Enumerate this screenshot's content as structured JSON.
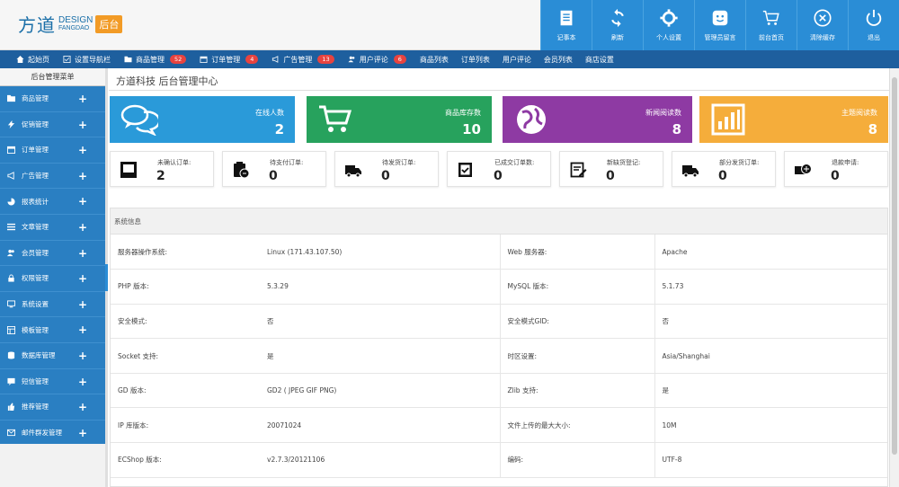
{
  "header": {
    "logo_cn": "方道",
    "logo_en1": "DESIGN",
    "logo_en2": "FANGDAO",
    "logo_badge": "后台",
    "tools": [
      {
        "label": "记事本",
        "icon": "notepad-icon"
      },
      {
        "label": "刷新",
        "icon": "refresh-icon"
      },
      {
        "label": "个人设置",
        "icon": "gear-icon"
      },
      {
        "label": "管理员留言",
        "icon": "message-icon"
      },
      {
        "label": "前台首页",
        "icon": "cart-icon"
      },
      {
        "label": "清除缓存",
        "icon": "close-circle-icon"
      },
      {
        "label": "退出",
        "icon": "power-icon"
      }
    ]
  },
  "nav": {
    "home": "起始页",
    "settings": "设置导航栏",
    "goods": "商品管理",
    "goods_badge": "52",
    "orders": "订单管理",
    "orders_badge": "4",
    "ads": "广告管理",
    "ads_badge": "13",
    "comments": "用户评论",
    "comments_badge": "6",
    "links": [
      "商品列表",
      "订单列表",
      "用户评论",
      "会员列表",
      "商店设置"
    ]
  },
  "sidebar": {
    "title": "后台管理菜单",
    "items": [
      {
        "label": "商品管理",
        "icon": "folder-icon"
      },
      {
        "label": "促销管理",
        "icon": "bolt-icon"
      },
      {
        "label": "订单管理",
        "icon": "calendar-icon"
      },
      {
        "label": "广告管理",
        "icon": "megaphone-icon"
      },
      {
        "label": "报表统计",
        "icon": "pie-icon"
      },
      {
        "label": "文章管理",
        "icon": "list-icon"
      },
      {
        "label": "会员管理",
        "icon": "users-icon"
      },
      {
        "label": "权限管理",
        "icon": "lock-icon"
      },
      {
        "label": "系统设置",
        "icon": "monitor-icon"
      },
      {
        "label": "模板管理",
        "icon": "template-icon"
      },
      {
        "label": "数据库管理",
        "icon": "database-icon"
      },
      {
        "label": "短信管理",
        "icon": "sms-icon"
      },
      {
        "label": "推荐管理",
        "icon": "thumb-icon"
      },
      {
        "label": "邮件群发管理",
        "icon": "mail-icon"
      }
    ]
  },
  "main": {
    "title": "方道科技 后台管理中心",
    "stats": [
      {
        "label": "在线人数",
        "value": "2",
        "color": "#2a9ad9",
        "icon": "chat-icon"
      },
      {
        "label": "商品库存数",
        "value": "10",
        "color": "#27a25d",
        "icon": "cart-icon"
      },
      {
        "label": "新闻阅读数",
        "value": "8",
        "color": "#8e3aa3",
        "icon": "globe-icon"
      },
      {
        "label": "主题阅读数",
        "value": "8",
        "color": "#f5ad3b",
        "icon": "bar-chart-icon"
      }
    ],
    "orders": [
      {
        "label": "未确认订单:",
        "value": "2",
        "icon": "inbox-icon"
      },
      {
        "label": "待支付订单:",
        "value": "0",
        "icon": "pay-icon"
      },
      {
        "label": "待发货订单:",
        "value": "0",
        "icon": "truck-icon"
      },
      {
        "label": "已成交订单数:",
        "value": "0",
        "icon": "check-doc-icon"
      },
      {
        "label": "新缺货登记:",
        "value": "0",
        "icon": "edit-doc-icon"
      },
      {
        "label": "部分发货订单:",
        "value": "0",
        "icon": "truck-icon"
      },
      {
        "label": "退款申请:",
        "value": "0",
        "icon": "refund-icon"
      }
    ],
    "sys_title": "系统信息",
    "sys_rows": [
      [
        "服务器操作系统:",
        "Linux (171.43.107.50)",
        "Web 服务器:",
        "Apache"
      ],
      [
        "PHP 版本:",
        "5.3.29",
        "MySQL 版本:",
        "5.1.73"
      ],
      [
        "安全模式:",
        "否",
        "安全模式GID:",
        "否"
      ],
      [
        "Socket 支持:",
        "是",
        "时区设置:",
        "Asia/Shanghai"
      ],
      [
        "GD 版本:",
        "GD2 ( JPEG GIF PNG)",
        "Zlib 支持:",
        "是"
      ],
      [
        "IP 库版本:",
        "20071024",
        "文件上传的最大大小:",
        "10M"
      ],
      [
        "ECShop 版本:",
        "v2.7.3/20121106",
        "编码:",
        "UTF-8"
      ]
    ]
  }
}
